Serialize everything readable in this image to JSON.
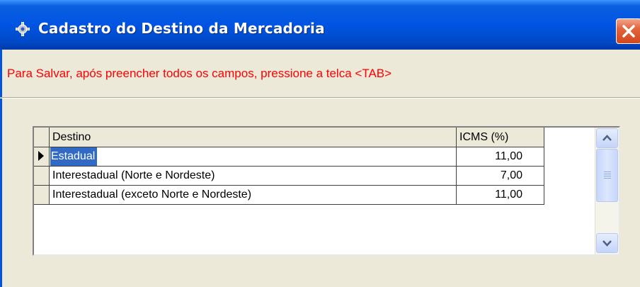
{
  "window": {
    "title": "Cadastro do Destino da Mercadoria"
  },
  "message": "Para Salvar, após preencher todos os campos,  pressione a telca <TAB>",
  "grid": {
    "columns": [
      "Destino",
      "ICMS (%)"
    ],
    "rows": [
      {
        "destino": "Estadual",
        "icms": "11,00",
        "selected": true
      },
      {
        "destino": "Interestadual (Norte e Nordeste)",
        "icms": "7,00",
        "selected": false
      },
      {
        "destino": "Interestadual (exceto Norte e Nordeste)",
        "icms": "11,00",
        "selected": false
      }
    ]
  },
  "colors": {
    "titlebar": "#0054e3",
    "message": "#ff0000",
    "selection": "#316ac5"
  },
  "icons": {
    "title": "gear-icon",
    "close": "close-icon",
    "scroll_up": "chevron-up-icon",
    "scroll_down": "chevron-down-icon"
  }
}
